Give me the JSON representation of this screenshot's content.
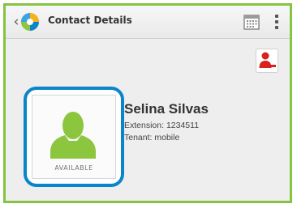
{
  "header": {
    "title": "Contact Details"
  },
  "contact": {
    "name": "Selina Silvas",
    "extension": "Extension: 1234511",
    "tenant": "Tenant: mobile",
    "presence": "AVAILABLE"
  },
  "icons": {
    "back": "chevron-left-icon",
    "app_logo": "app-logo-icon",
    "calendar": "calendar-icon",
    "overflow": "overflow-menu-icon",
    "remove_contact": "remove-contact-icon",
    "avatar": "person-silhouette-icon"
  },
  "colors": {
    "frame_border": "#85c441",
    "avatar_highlight": "#0a85c9",
    "presence_available": "#8cc63f",
    "remove_contact": "#d9221c"
  }
}
